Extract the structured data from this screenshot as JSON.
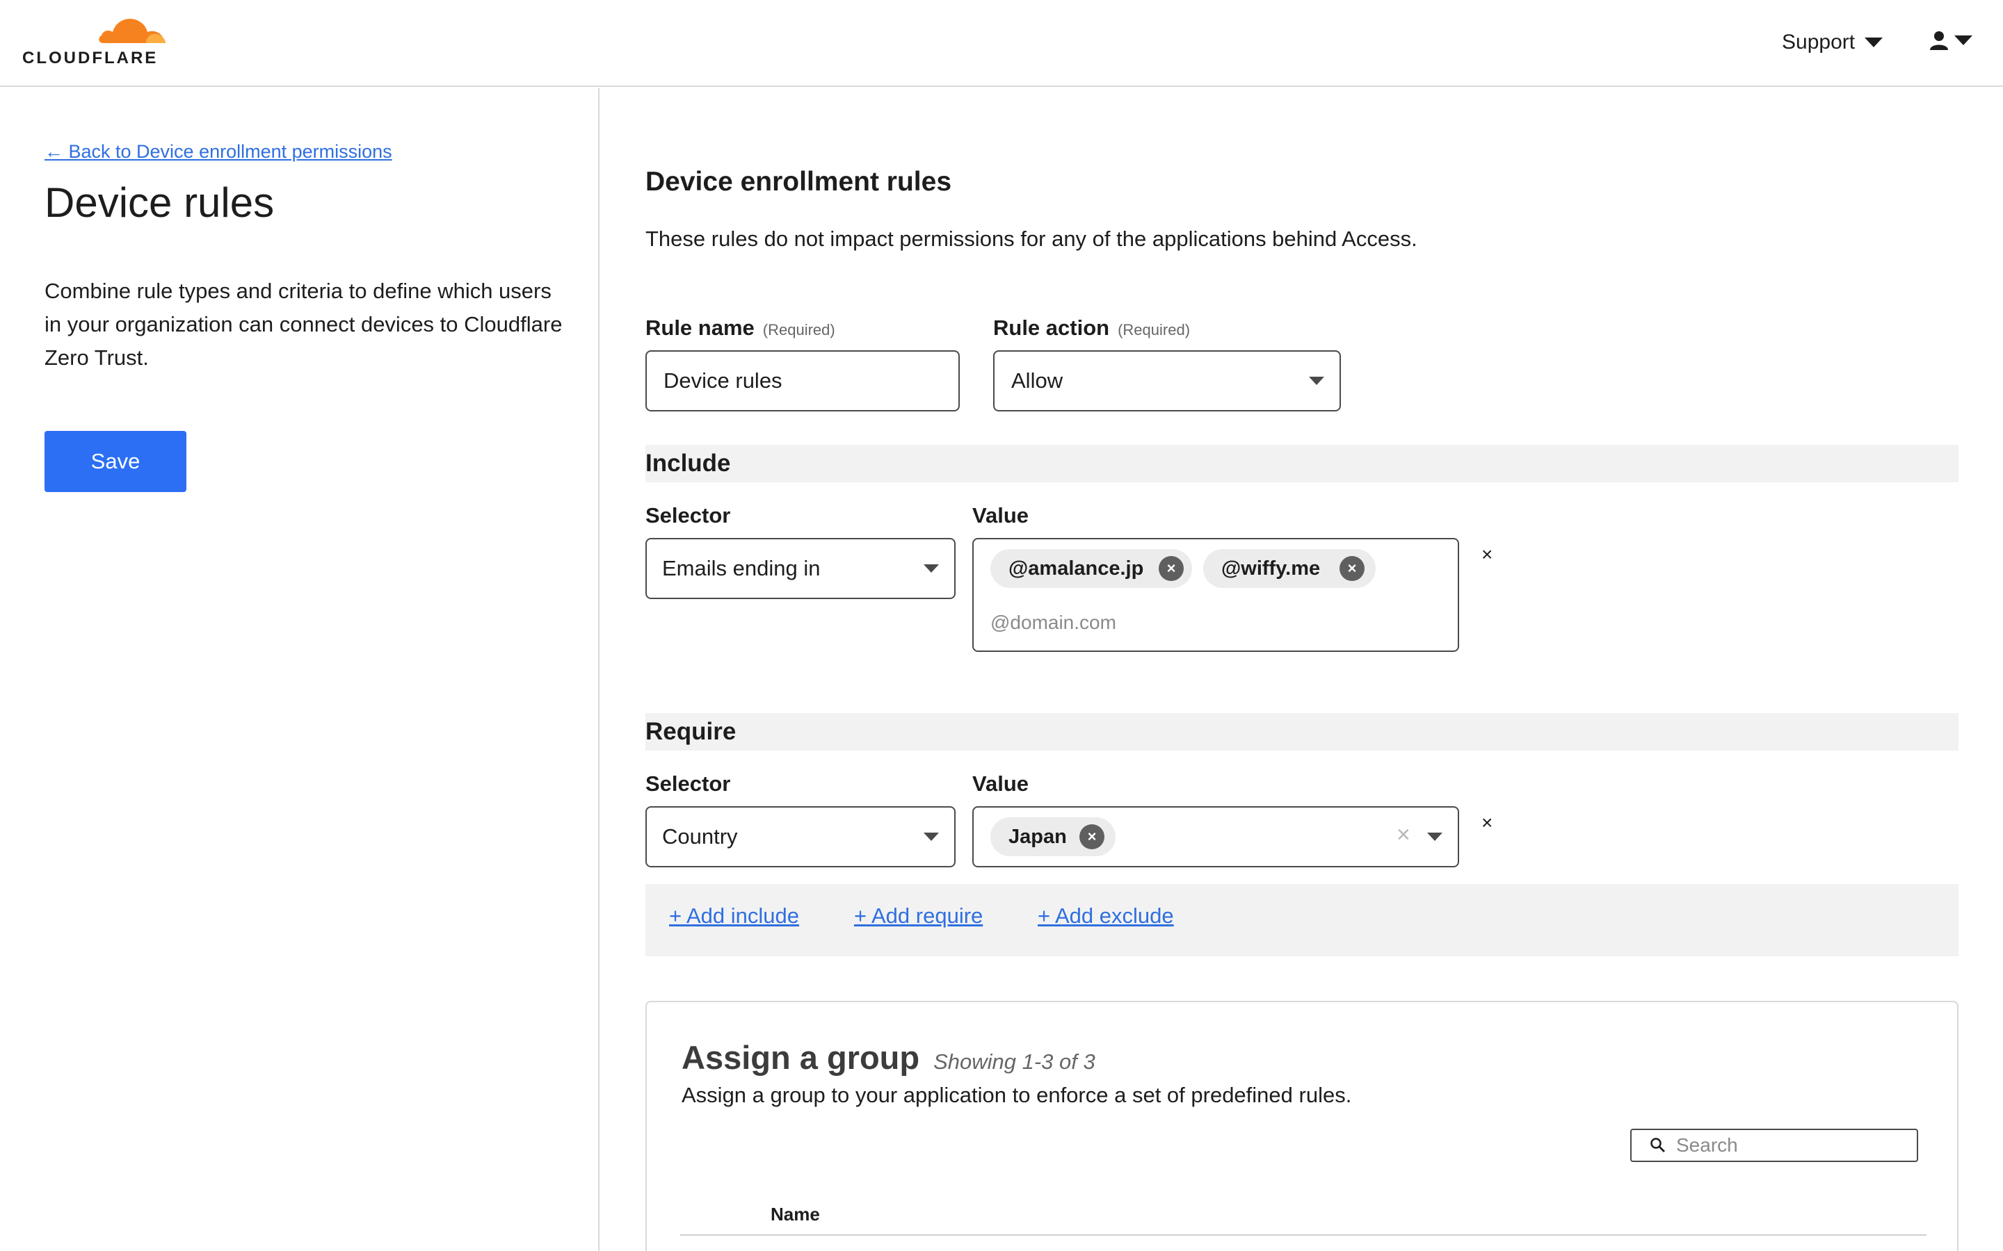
{
  "header": {
    "logo_text": "CLOUDFLARE",
    "support_label": "Support",
    "user_icon": "user-icon",
    "brand_color": "#f6821f"
  },
  "sidebar": {
    "back_link": "← Back to Device enrollment permissions",
    "title": "Device rules",
    "description": "Combine rule types and criteria to define which users in your organization can connect devices to Cloudflare Zero Trust.",
    "save_label": "Save",
    "accent_color": "#2c6ff5"
  },
  "main": {
    "title": "Device enrollment rules",
    "subtitle": "These rules do not impact permissions for any of the applications behind Access.",
    "rule_name": {
      "label": "Rule name",
      "required": "(Required)",
      "value": "Device rules"
    },
    "rule_action": {
      "label": "Rule action",
      "required": "(Required)",
      "value": "Allow"
    },
    "include": {
      "title": "Include",
      "selector_label": "Selector",
      "value_label": "Value",
      "selector_value": "Emails ending in",
      "chips": [
        "@amalance.jp",
        "@wiffy.me"
      ],
      "placeholder": "@domain.com",
      "remove_symbol": "×"
    },
    "require": {
      "title": "Require",
      "selector_label": "Selector",
      "value_label": "Value",
      "selector_value": "Country",
      "chips": [
        "Japan"
      ],
      "remove_symbol": "×"
    },
    "add_links": {
      "include": "+ Add include",
      "require": "+ Add require",
      "exclude": "+ Add exclude"
    },
    "group": {
      "title": "Assign a group",
      "count": "Showing 1-3 of 3",
      "description": "Assign a group to your application to enforce a set of predefined rules.",
      "search_placeholder": "Search",
      "column_name": "Name"
    }
  }
}
